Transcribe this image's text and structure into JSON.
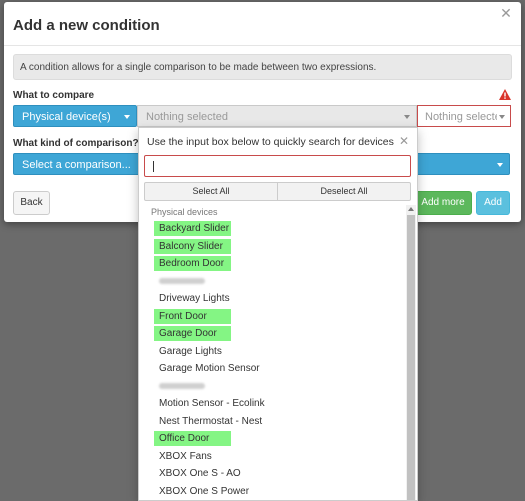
{
  "modal": {
    "title": "Add a new condition",
    "info_text": "A condition allows for a single comparison to be made between two expressions.",
    "compare_label": "What to compare",
    "comparison_label": "What kind of comparison?"
  },
  "compare_row": {
    "type_selected": "Physical device(s)",
    "device_placeholder": "Nothing selected",
    "attribute_placeholder": "Nothing selected"
  },
  "comparison_select": {
    "placeholder": "Select a comparison..."
  },
  "footer": {
    "back": "Back",
    "add_more": "Add more",
    "add": "Add"
  },
  "dropdown": {
    "header": "Use the input box below to quickly search for devices",
    "search_value": "",
    "select_all": "Select All",
    "deselect_all": "Deselect All",
    "group_label": "Physical devices",
    "items": [
      {
        "label": "Backyard Slider",
        "highlighted": true,
        "blurred": false
      },
      {
        "label": "Balcony Slider",
        "highlighted": true,
        "blurred": false
      },
      {
        "label": "Bedroom Door",
        "highlighted": true,
        "blurred": false
      },
      {
        "label": "",
        "highlighted": false,
        "blurred": true
      },
      {
        "label": "Driveway Lights",
        "highlighted": false,
        "blurred": false
      },
      {
        "label": "Front Door",
        "highlighted": true,
        "blurred": false
      },
      {
        "label": "Garage Door",
        "highlighted": true,
        "blurred": false
      },
      {
        "label": "Garage Lights",
        "highlighted": false,
        "blurred": false
      },
      {
        "label": "Garage Motion Sensor",
        "highlighted": false,
        "blurred": false
      },
      {
        "label": "",
        "highlighted": false,
        "blurred": true
      },
      {
        "label": "Motion Sensor - Ecolink",
        "highlighted": false,
        "blurred": false
      },
      {
        "label": "Nest Thermostat - Nest",
        "highlighted": false,
        "blurred": false
      },
      {
        "label": "Office Door",
        "highlighted": true,
        "blurred": false
      },
      {
        "label": "XBOX Fans",
        "highlighted": false,
        "blurred": false
      },
      {
        "label": "XBOX One S - AO",
        "highlighted": false,
        "blurred": false
      },
      {
        "label": "XBOX One S Power",
        "highlighted": false,
        "blurred": false
      }
    ]
  },
  "colors": {
    "overlay": "#6b6b6b",
    "primary": "#3ea6d6",
    "error_border": "#c84b4b",
    "highlight": "#84f584",
    "success": "#5cb85c",
    "info": "#5bc0de"
  },
  "icons": {
    "close": "close-icon",
    "warning": "warning-icon",
    "caret": "caret-down-icon"
  }
}
